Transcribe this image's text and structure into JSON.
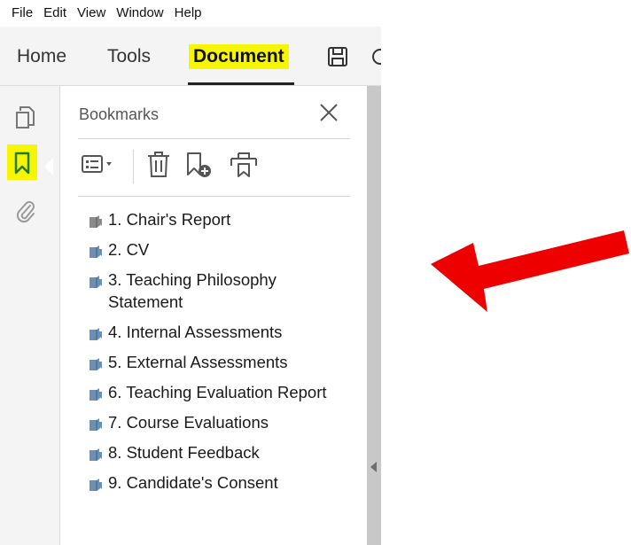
{
  "menu": [
    "File",
    "Edit",
    "View",
    "Window",
    "Help"
  ],
  "tabs": {
    "home": "Home",
    "tools": "Tools",
    "document": "Document"
  },
  "bookmarks_panel": {
    "title": "Bookmarks",
    "items": [
      "1. Chair's Report",
      "2. CV",
      "3. Teaching Philosophy Statement",
      "4. Internal Assessments",
      "5. External Assessments",
      "6. Teaching Evaluation Report",
      "7. Course Evaluations",
      "8. Student Feedback",
      "9. Candidate's Consent"
    ]
  },
  "icons": {
    "save": "save-icon",
    "cloud": "cloud-icon",
    "pages": "page-thumbnails-icon",
    "bookmark": "bookmark-icon",
    "attachment": "paperclip-icon",
    "options": "options-menu-icon",
    "delete": "trash-icon",
    "new_bookmark": "new-bookmark-icon",
    "tag_bookmark": "bookmark-from-structure-icon",
    "close": "close-icon",
    "annotation": "red-arrow-icon"
  },
  "colors": {
    "highlight": "#f6f600",
    "annotation_arrow": "#ee0000",
    "bookmark_icon_blue": "#6b8fb5",
    "bookmark_icon_grey": "#8a8a8a"
  }
}
